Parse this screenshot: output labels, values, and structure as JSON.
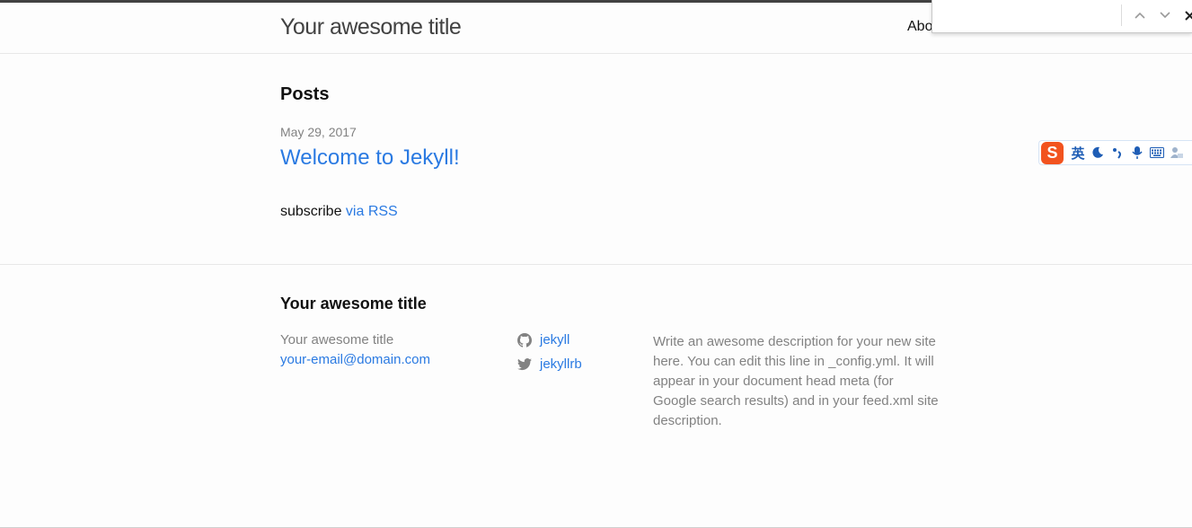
{
  "header": {
    "site_title": "Your awesome title",
    "nav_about": "Abo"
  },
  "find_bar": {
    "query": "",
    "prev_icon": "chevron-up-icon",
    "next_icon": "chevron-down-icon",
    "close_icon": "close-icon"
  },
  "main": {
    "heading": "Posts",
    "posts": [
      {
        "date": "May 29, 2017",
        "title": "Welcome to Jekyll!"
      }
    ],
    "subscribe_text": "subscribe ",
    "rss_link": "via RSS"
  },
  "ime_toolbar": {
    "logo": "S",
    "mode": "英",
    "icons": [
      "moon-icon",
      "punctuation-icon",
      "microphone-icon",
      "keyboard-icon",
      "user-icon"
    ]
  },
  "footer": {
    "heading": "Your awesome title",
    "contact_name": "Your awesome title",
    "contact_email": "your-email@domain.com",
    "github_username": "jekyll",
    "twitter_username": "jekyllrb",
    "description": "Write an awesome description for your new site here. You can edit this line in _config.yml. It will appear in your document head meta (for Google search results) and in your feed.xml site description."
  },
  "colors": {
    "link": "#2a7ae2",
    "muted": "#828282",
    "text": "#111111",
    "header_border": "#424242",
    "ime_logo": "#f2531f"
  }
}
